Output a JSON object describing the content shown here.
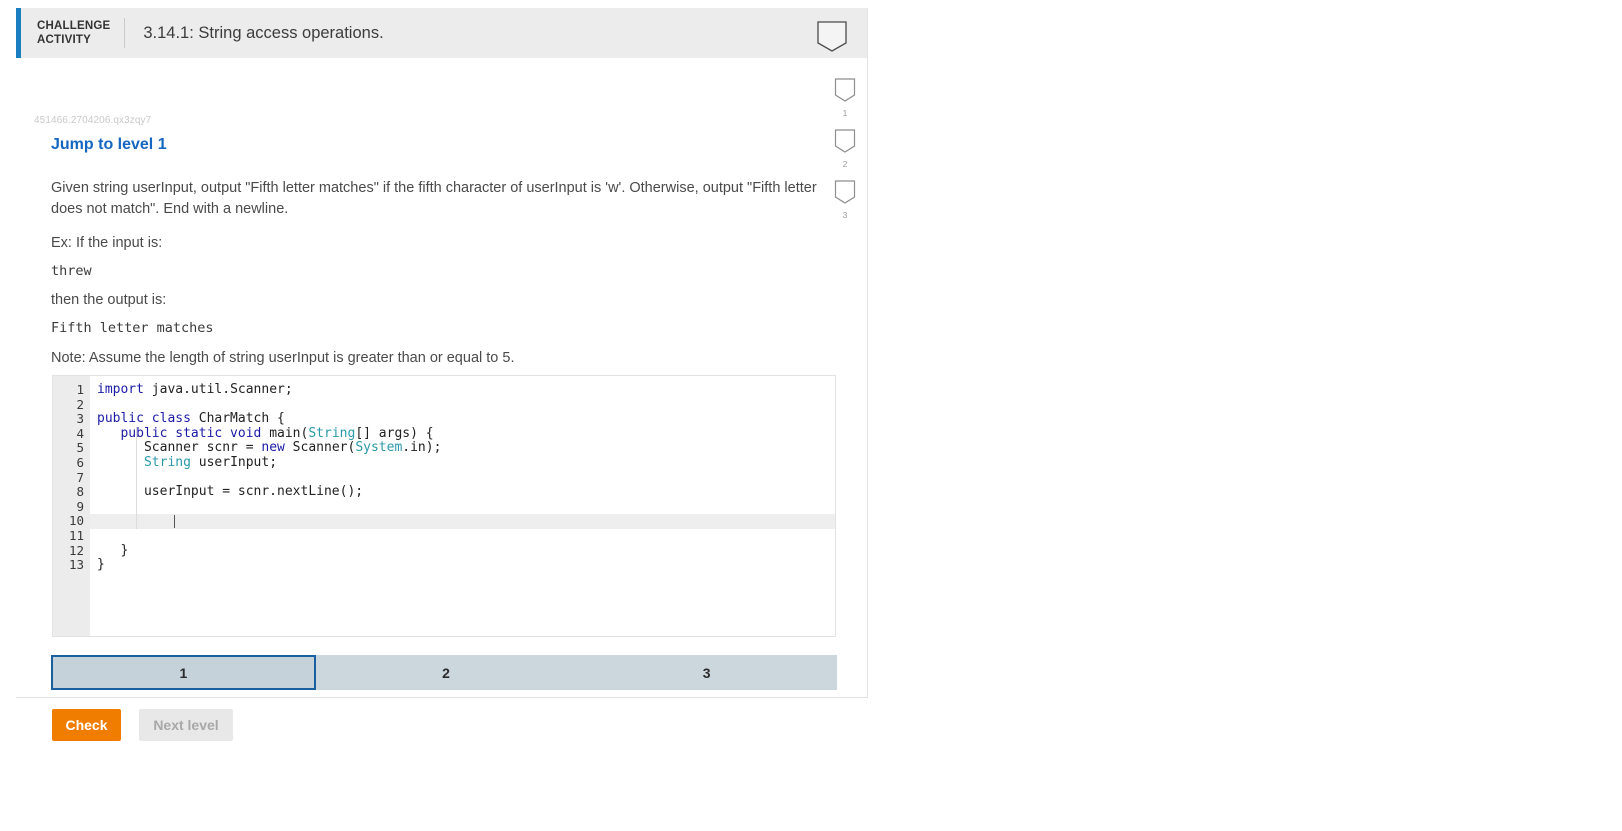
{
  "header": {
    "badge_line1": "CHALLENGE",
    "badge_line2": "ACTIVITY",
    "title": "3.14.1: String access operations.",
    "bookmark_icon": "bookmark-icon"
  },
  "activity": {
    "id": "451466.2704206.qx3zqy7",
    "jump_link": "Jump to level 1",
    "prompt": "Given string userInput, output \"Fifth letter matches\" if the fifth character of userInput is 'w'. Otherwise, output \"Fifth letter does not match\". End with a newline.",
    "example_intro": "Ex: If the input is:",
    "example_input": "threw",
    "example_then": "then the output is:",
    "example_output": "Fifth letter matches",
    "note": "Note: Assume the length of string userInput is greater than or equal to 5."
  },
  "editor": {
    "line_numbers": [
      "1",
      "2",
      "3",
      "4",
      "5",
      "6",
      "7",
      "8",
      "9",
      "10",
      "11",
      "12",
      "13"
    ],
    "active_line": 10,
    "lines": [
      [
        {
          "t": "import ",
          "c": "k"
        },
        {
          "t": "java.util.Scanner;",
          "c": "p"
        }
      ],
      [],
      [
        {
          "t": "public class ",
          "c": "k"
        },
        {
          "t": "CharMatch",
          "c": "p"
        },
        {
          "t": " {",
          "c": "p"
        }
      ],
      [
        {
          "t": "   ",
          "c": "p"
        },
        {
          "t": "public static void ",
          "c": "k"
        },
        {
          "t": "main(",
          "c": "p"
        },
        {
          "t": "String",
          "c": "t"
        },
        {
          "t": "[] args) {",
          "c": "p"
        }
      ],
      [
        {
          "t": "      Scanner scnr = ",
          "c": "p"
        },
        {
          "t": "new",
          "c": "k"
        },
        {
          "t": " Scanner(",
          "c": "p"
        },
        {
          "t": "System",
          "c": "t"
        },
        {
          "t": ".in);",
          "c": "p"
        }
      ],
      [
        {
          "t": "      ",
          "c": "p"
        },
        {
          "t": "String",
          "c": "t"
        },
        {
          "t": " userInput;",
          "c": "p"
        }
      ],
      [],
      [
        {
          "t": "      userInput = scnr.nextLine();",
          "c": "p"
        }
      ],
      [],
      [],
      [],
      [
        {
          "t": "   }",
          "c": "p"
        }
      ],
      [
        {
          "t": "}",
          "c": "p"
        }
      ]
    ]
  },
  "levels": {
    "tabs": [
      {
        "label": "1",
        "active": true
      },
      {
        "label": "2",
        "active": false
      },
      {
        "label": "3",
        "active": false
      }
    ]
  },
  "buttons": {
    "check": "Check",
    "next_level": "Next level"
  },
  "rail": {
    "items": [
      {
        "number": "1",
        "icon": "bookmark-icon"
      },
      {
        "number": "2",
        "icon": "bookmark-icon"
      },
      {
        "number": "3",
        "icon": "bookmark-icon"
      }
    ]
  },
  "colors": {
    "accent_blue": "#1a7fc1",
    "link_blue": "#1566c0",
    "check_orange": "#f07c00",
    "tab_gray": "#ccd6dd",
    "tab_border_active": "#1a5fa0",
    "keyword": "#1b1ba6",
    "type": "#2a9aa8"
  }
}
